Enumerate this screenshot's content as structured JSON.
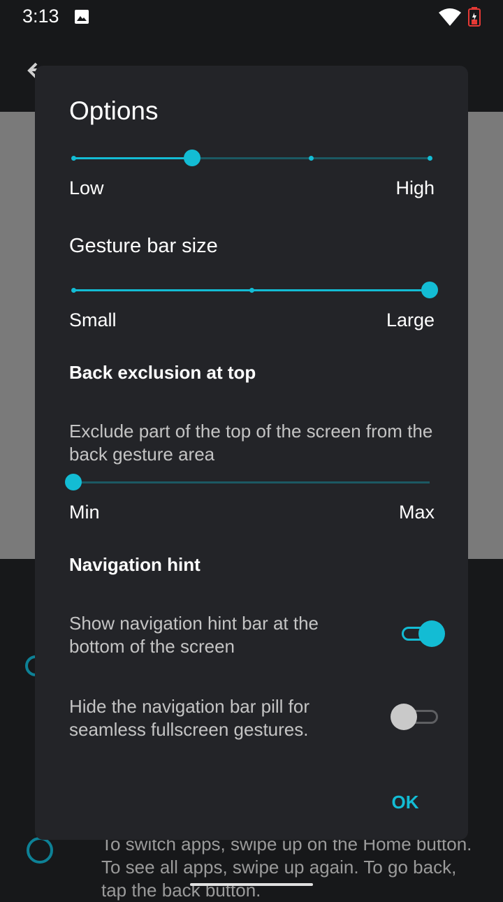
{
  "status_bar": {
    "time": "3:13"
  },
  "background": {
    "description": "To switch apps, swipe up on the Home button. To see all apps, swipe up again. To go back, tap the back button."
  },
  "dialog": {
    "title": "Options",
    "sensitivity": {
      "min_label": "Low",
      "max_label": "High",
      "stops": 4,
      "value_index": 1
    },
    "gesture_bar_size": {
      "heading": "Gesture bar size",
      "min_label": "Small",
      "max_label": "Large",
      "stops": 3,
      "value_index": 2
    },
    "back_exclusion": {
      "heading": "Back exclusion at top",
      "description": "Exclude part of the top of the screen from the back gesture area",
      "min_label": "Min",
      "max_label": "Max",
      "value_fraction": 0
    },
    "navigation_hint": {
      "heading": "Navigation hint",
      "show_hint": {
        "label": "Show navigation hint bar at the bottom of the screen",
        "enabled": true
      },
      "hide_pill": {
        "label": "Hide the navigation bar pill for seamless fullscreen gestures.",
        "enabled": false
      }
    },
    "ok_label": "OK"
  },
  "colors": {
    "accent": "#13bcd4",
    "dialog_bg": "#232428",
    "track_inactive": "#1c5963"
  }
}
